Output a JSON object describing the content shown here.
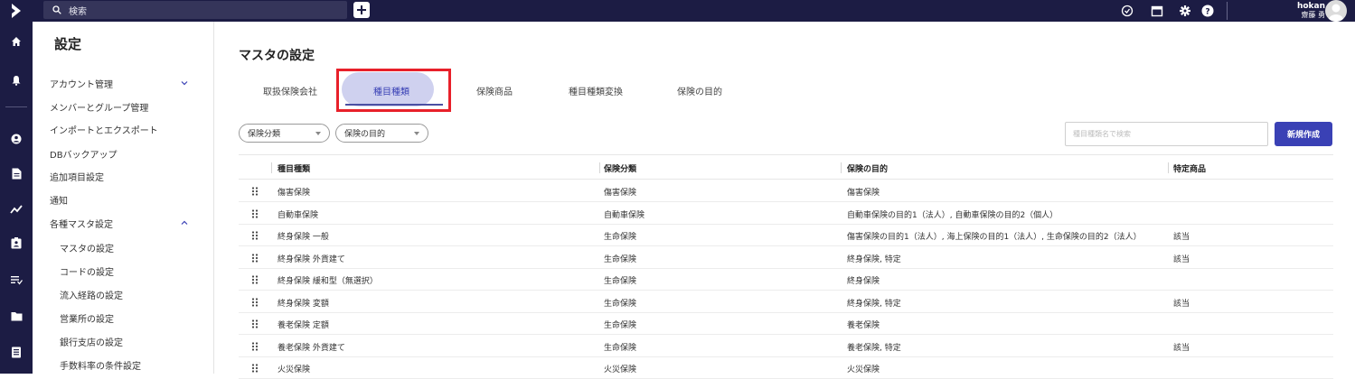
{
  "topbar": {
    "search_label": "検索",
    "user_id": "hokan",
    "user_name": "齋藤 勇"
  },
  "sidebar": {
    "title": "設定",
    "items": [
      {
        "label": "アカウント管理",
        "expanded": true
      },
      {
        "label": "メンバーとグループ管理"
      },
      {
        "label": "インポートとエクスポート"
      },
      {
        "label": "DBバックアップ"
      },
      {
        "label": "追加項目設定"
      },
      {
        "label": "通知"
      },
      {
        "label": "各種マスタ設定",
        "expanded": true
      },
      {
        "label": "マスタの設定"
      },
      {
        "label": "コードの設定"
      },
      {
        "label": "流入経路の設定"
      },
      {
        "label": "営業所の設定"
      },
      {
        "label": "銀行支店の設定"
      },
      {
        "label": "手数料率の条件設定"
      }
    ]
  },
  "main": {
    "title": "マスタの設定",
    "tabs": [
      "取扱保険会社",
      "種目種類",
      "保険商品",
      "種目種類変換",
      "保険の目的"
    ],
    "active_tab": "種目種類",
    "filters": [
      "保険分類",
      "保険の目的"
    ],
    "search_placeholder": "種目種類名で検索",
    "new_button": "新規作成",
    "columns": [
      "種目種類",
      "保険分類",
      "保険の目的",
      "特定商品"
    ],
    "rows": [
      [
        "傷害保険",
        "傷害保険",
        "傷害保険",
        ""
      ],
      [
        "自動車保険",
        "自動車保険",
        "自動車保険の目的1（法人）, 自動車保険の目的2（個人）",
        ""
      ],
      [
        "終身保険 一般",
        "生命保険",
        "傷害保険の目的1（法人）, 海上保険の目的1（法人）, 生命保険の目的2（法人）",
        "該当"
      ],
      [
        "終身保険 外貨建て",
        "生命保険",
        "終身保険, 特定",
        "該当"
      ],
      [
        "終身保険 緩和型（無選択）",
        "生命保険",
        "終身保険",
        ""
      ],
      [
        "終身保険 変額",
        "生命保険",
        "終身保険, 特定",
        "該当"
      ],
      [
        "養老保険 定額",
        "生命保険",
        "養老保険",
        ""
      ],
      [
        "養老保険 外貨建て",
        "生命保険",
        "養老保険, 特定",
        "該当"
      ],
      [
        "火災保険",
        "火災保険",
        "火災保険",
        ""
      ]
    ]
  },
  "colors": {
    "nav_bg": "#1c1c44",
    "accent": "#3a41b5",
    "active_tab_bg": "#cfd1ef",
    "highlight_border": "#e8202a"
  }
}
